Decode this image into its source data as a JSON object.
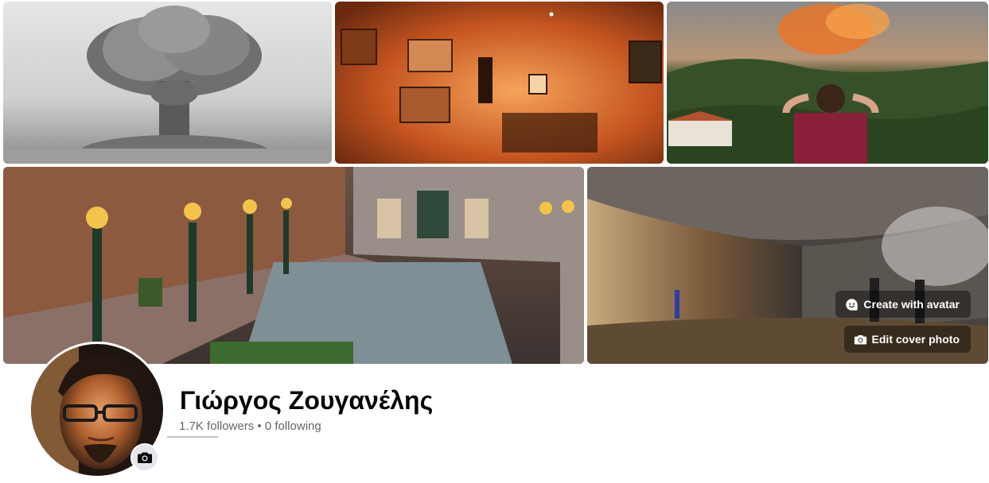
{
  "cover": {
    "tiles": [
      {
        "icon": "mushroom-cloud-photo"
      },
      {
        "icon": "underground-cafe-photo"
      },
      {
        "icon": "forest-fire-photo"
      },
      {
        "icon": "lamp-lit-street-photo"
      },
      {
        "icon": "cave-wall-photo"
      }
    ],
    "create_avatar_label": "Create with avatar",
    "edit_cover_label": "Edit cover photo"
  },
  "profile": {
    "name": "Γιώργος Ζουγανέλης",
    "followers": "1.7K followers",
    "separator": "•",
    "following": "0 following"
  },
  "colors": {
    "name_text": "#050505",
    "secondary_text": "#65676b",
    "button_overlay": "rgba(0,0,0,0.42)",
    "camera_button_bg": "#e4e6eb"
  }
}
